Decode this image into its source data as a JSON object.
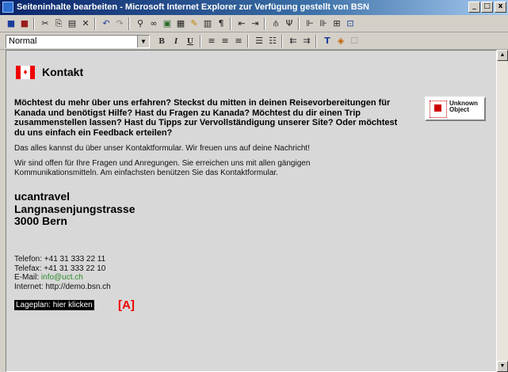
{
  "window": {
    "title": "Seiteninhalte bearbeiten - Microsoft Internet Explorer zur Verfügung gestellt von BSN",
    "minimize": "_",
    "maximize": "□",
    "close": "x"
  },
  "toolbar": {
    "style_value": "Normal",
    "bold": "B",
    "italic": "I",
    "underline": "U"
  },
  "page": {
    "heading": "Kontakt",
    "intro": "Möchtest du mehr über uns erfahren? Steckst du mitten in deinen Reisevorbereitungen für Kanada und benötigst Hilfe? Hast du Fragen zu Kanada? Möchtest du dir einen Trip zusammenstellen lassen? Hast du Tipps zur Vervollständigung unserer Site? Oder möchtest du uns einfach ein Feedback erteilen?",
    "p1": "Das alles kannst du über unser Kontaktformular. Wir freuen uns auf deine Nachricht!",
    "p2": "Wir sind offen für Ihre Fragen und Anregungen. Sie erreichen uns mit allen gängigen Kommunikationsmitteln. Am einfachsten benützen Sie das Kontaktformular.",
    "unknown_object": "Unknown\nObject",
    "address": {
      "company": "ucantravel",
      "street": "Langnasenjungstrasse",
      "city": "3000 Bern"
    },
    "contact": {
      "telefon": "Telefon: +41 31 333 22 11",
      "telefax": "Telefax: +41 31 333 22 10",
      "email_label": "E-Mail: ",
      "email": "info@uct.ch",
      "internet": "Internet: http://demo.bsn.ch"
    },
    "lageplan": "Lageplan: hier klicken",
    "marker": "[A]"
  },
  "icons": [
    "save-icon",
    "save-close-icon",
    "cut-icon",
    "copy-icon",
    "paste-icon",
    "delete-icon",
    "undo-icon",
    "redo-icon",
    "find-icon",
    "link-icon",
    "image-icon",
    "table-icon",
    "edit-icon",
    "source-icon",
    "paragraph-icon",
    "indent-icon",
    "outdent-icon",
    "tool-icons"
  ]
}
